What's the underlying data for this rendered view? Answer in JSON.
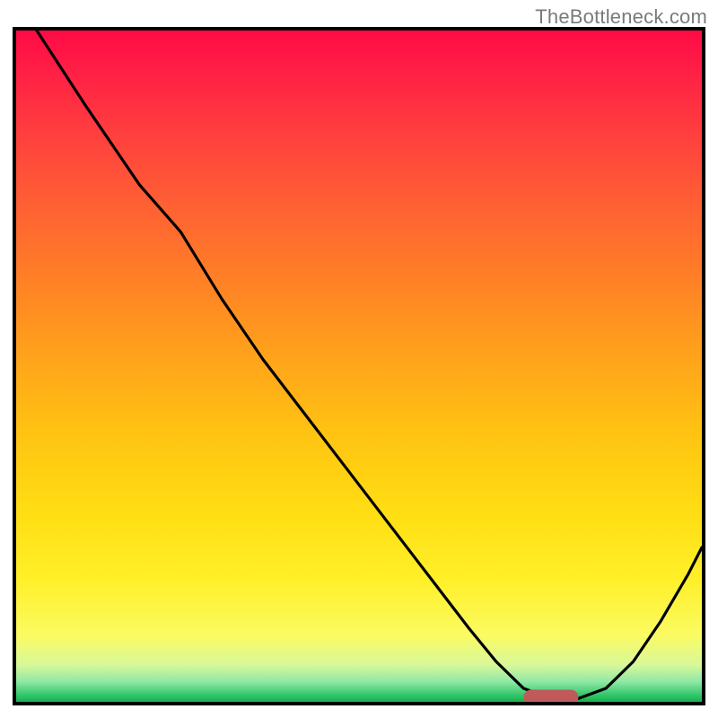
{
  "watermark": {
    "text": "TheBottleneck.com"
  },
  "chart_data": {
    "type": "line",
    "title": "",
    "xlabel": "",
    "ylabel": "",
    "xlim": [
      0,
      100
    ],
    "ylim": [
      0,
      100
    ],
    "legend": false,
    "grid": false,
    "background": "rainbow-vertical-gradient",
    "series": [
      {
        "name": "bottleneck-curve",
        "color": "#000000",
        "x": [
          3,
          10,
          18,
          24,
          30,
          36,
          42,
          48,
          54,
          60,
          66,
          70,
          74,
          78,
          82,
          86,
          90,
          94,
          98,
          100
        ],
        "y": [
          100,
          89,
          77,
          70,
          60,
          51,
          43,
          35,
          27,
          19,
          11,
          6,
          2,
          0.5,
          0.5,
          2,
          6,
          12,
          19,
          23
        ]
      }
    ],
    "marker": {
      "name": "optimal-range-marker",
      "color": "#c05a5a",
      "x_start": 74,
      "x_end": 82,
      "y": 0.7,
      "thickness": 2.2
    }
  }
}
